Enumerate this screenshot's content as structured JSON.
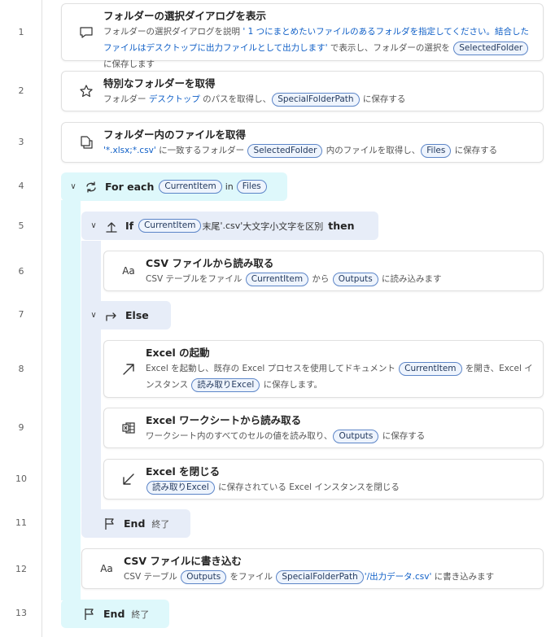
{
  "line_numbers": [
    "1",
    "2",
    "3",
    "4",
    "5",
    "6",
    "7",
    "8",
    "9",
    "10",
    "11",
    "12",
    "13"
  ],
  "step1": {
    "title": "フォルダーの選択ダイアログを表示",
    "desc_a": "フォルダーの選択ダイアログを説明 ",
    "desc_link": "' 1 つにまとめたいファイルのあるフォルダを指定してください。結合したファイルはデスクトップに出力ファイルとして出力します'",
    "desc_b": " で表示し、フォルダーの選択を ",
    "var": "SelectedFolder",
    "desc_c": " に保存します"
  },
  "step2": {
    "title": "特別なフォルダーを取得",
    "desc_a": "フォルダー ",
    "desc_link": "デスクトップ",
    "desc_b": " のパスを取得し、",
    "var": "SpecialFolderPath",
    "desc_c": " に保存する"
  },
  "step3": {
    "title": "フォルダー内のファイルを取得",
    "desc_link": "'*.xlsx;*.csv'",
    "desc_a": " に一致するフォルダー ",
    "var1": "SelectedFolder",
    "desc_b": " 内のファイルを取得し、",
    "var2": "Files",
    "desc_c": " に保存する"
  },
  "foreach": {
    "kw": "For each",
    "var1": "CurrentItem",
    "in": "in",
    "var2": "Files"
  },
  "if": {
    "kw": "If",
    "var": "CurrentItem",
    "cond_a": "末尾",
    "cond_link": "'.csv'",
    "cond_b": "大文字小文字を区別",
    "then": "then"
  },
  "step6": {
    "title": "CSV ファイルから読み取る",
    "desc_a": "CSV テーブルをファイル ",
    "var1": "CurrentItem",
    "desc_b": " から ",
    "var2": "Outputs",
    "desc_c": " に読み込みます"
  },
  "else": {
    "kw": "Else"
  },
  "step8": {
    "title": "Excel の起動",
    "desc_a": "Excel を起動し、既存の Excel プロセスを使用してドキュメント ",
    "var1": "CurrentItem",
    "desc_b": " を開き、Excel インスタンス ",
    "var2": "読み取りExcel",
    "desc_c": " に保存します。"
  },
  "step9": {
    "title": "Excel ワークシートから読み取る",
    "desc_a": "ワークシート内のすべてのセルの値を読み取り、",
    "var": "Outputs",
    "desc_b": " に保存する"
  },
  "step10": {
    "title": "Excel を閉じる",
    "var": "読み取りExcel",
    "desc_a": " に保存されている Excel インスタンスを閉じる"
  },
  "end_if": {
    "kw": "End",
    "sub": "終了"
  },
  "step12": {
    "title": "CSV ファイルに書き込む",
    "desc_a": "CSV テーブル ",
    "var1": "Outputs",
    "desc_b": " をファイル ",
    "var2": "SpecialFolderPath",
    "desc_link": "'/出力データ.csv'",
    "desc_c": " に書き込みます"
  },
  "end_foreach": {
    "kw": "End",
    "sub": "終了"
  },
  "colors": {
    "accent_link": "#0f5fc7",
    "foreach_bg": "#def8fb",
    "if_bg": "#e7edf8",
    "pill_border": "#5c85c7"
  }
}
